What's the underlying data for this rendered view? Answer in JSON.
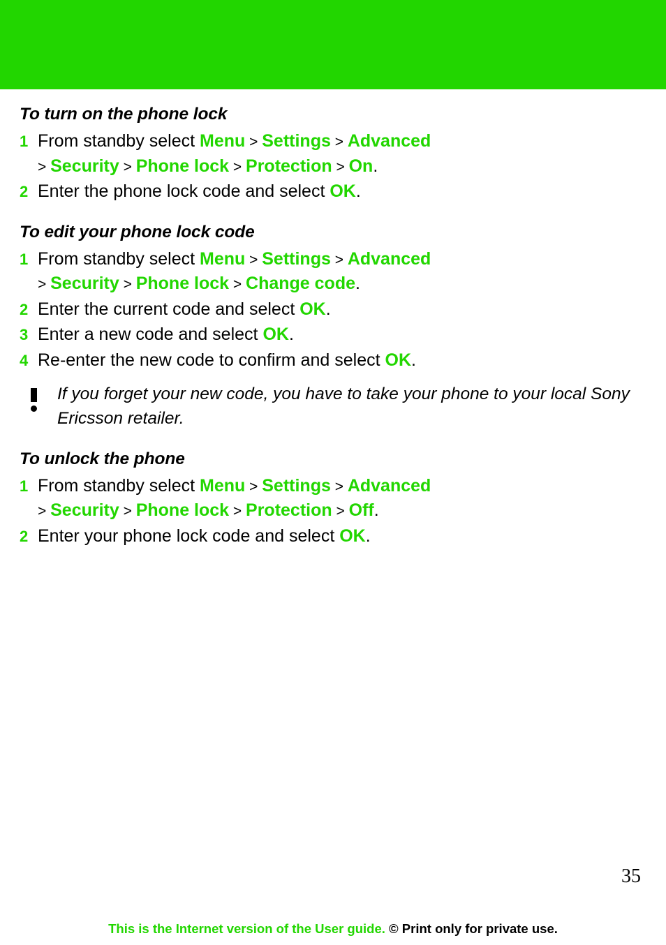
{
  "banner": {
    "color": "#22d600"
  },
  "accent_color": "#22d600",
  "sections": [
    {
      "title": "To turn on the phone lock",
      "steps": [
        {
          "num": "1",
          "parts": [
            {
              "t": "From standby select ",
              "s": "plain"
            },
            {
              "t": "Menu",
              "s": "accent"
            },
            {
              "t": " > ",
              "s": "sep"
            },
            {
              "t": "Settings",
              "s": "accent"
            },
            {
              "t": " > ",
              "s": "sep"
            },
            {
              "t": "Advanced",
              "s": "accent"
            },
            {
              "t": "\n> ",
              "s": "sep"
            },
            {
              "t": "Security",
              "s": "accent"
            },
            {
              "t": " > ",
              "s": "sep"
            },
            {
              "t": "Phone lock",
              "s": "accent"
            },
            {
              "t": " > ",
              "s": "sep"
            },
            {
              "t": "Protection",
              "s": "accent"
            },
            {
              "t": " > ",
              "s": "sep"
            },
            {
              "t": "On",
              "s": "accent"
            },
            {
              "t": ".",
              "s": "plain"
            }
          ]
        },
        {
          "num": "2",
          "parts": [
            {
              "t": "Enter the phone lock code and select ",
              "s": "plain"
            },
            {
              "t": "OK",
              "s": "accent"
            },
            {
              "t": ".",
              "s": "plain"
            }
          ]
        }
      ]
    },
    {
      "title": "To edit your phone lock code",
      "steps": [
        {
          "num": "1",
          "parts": [
            {
              "t": "From standby select ",
              "s": "plain"
            },
            {
              "t": "Menu",
              "s": "accent"
            },
            {
              "t": " > ",
              "s": "sep"
            },
            {
              "t": "Settings",
              "s": "accent"
            },
            {
              "t": " > ",
              "s": "sep"
            },
            {
              "t": "Advanced",
              "s": "accent"
            },
            {
              "t": "\n> ",
              "s": "sep"
            },
            {
              "t": "Security",
              "s": "accent"
            },
            {
              "t": " > ",
              "s": "sep"
            },
            {
              "t": "Phone lock",
              "s": "accent"
            },
            {
              "t": " > ",
              "s": "sep"
            },
            {
              "t": "Change code",
              "s": "accent"
            },
            {
              "t": ".",
              "s": "plain"
            }
          ]
        },
        {
          "num": "2",
          "parts": [
            {
              "t": "Enter the current code and select ",
              "s": "plain"
            },
            {
              "t": "OK",
              "s": "accent"
            },
            {
              "t": ".",
              "s": "plain"
            }
          ]
        },
        {
          "num": "3",
          "parts": [
            {
              "t": "Enter a new code and select ",
              "s": "plain"
            },
            {
              "t": "OK",
              "s": "accent"
            },
            {
              "t": ".",
              "s": "plain"
            }
          ]
        },
        {
          "num": "4",
          "parts": [
            {
              "t": "Re-enter the new code to confirm and select ",
              "s": "plain"
            },
            {
              "t": "OK",
              "s": "accent"
            },
            {
              "t": ".",
              "s": "plain"
            }
          ]
        }
      ],
      "note": "If you forget your new code, you have to take your phone to your local Sony Ericsson retailer."
    },
    {
      "title": "To unlock the phone",
      "steps": [
        {
          "num": "1",
          "parts": [
            {
              "t": "From standby select ",
              "s": "plain"
            },
            {
              "t": "Menu",
              "s": "accent"
            },
            {
              "t": " > ",
              "s": "sep"
            },
            {
              "t": "Settings",
              "s": "accent"
            },
            {
              "t": " > ",
              "s": "sep"
            },
            {
              "t": "Advanced",
              "s": "accent"
            },
            {
              "t": "\n> ",
              "s": "sep"
            },
            {
              "t": "Security",
              "s": "accent"
            },
            {
              "t": " > ",
              "s": "sep"
            },
            {
              "t": "Phone lock",
              "s": "accent"
            },
            {
              "t": " > ",
              "s": "sep"
            },
            {
              "t": "Protection",
              "s": "accent"
            },
            {
              "t": " > ",
              "s": "sep"
            },
            {
              "t": "Off",
              "s": "accent"
            },
            {
              "t": ".",
              "s": "plain"
            }
          ]
        },
        {
          "num": "2",
          "parts": [
            {
              "t": "Enter your phone lock code and select ",
              "s": "plain"
            },
            {
              "t": "OK",
              "s": "accent"
            },
            {
              "t": ".",
              "s": "plain"
            }
          ]
        }
      ]
    }
  ],
  "page_number": "35",
  "footer": {
    "part1": "This is the Internet version of the User guide. ",
    "part2": "© Print only for private use."
  }
}
